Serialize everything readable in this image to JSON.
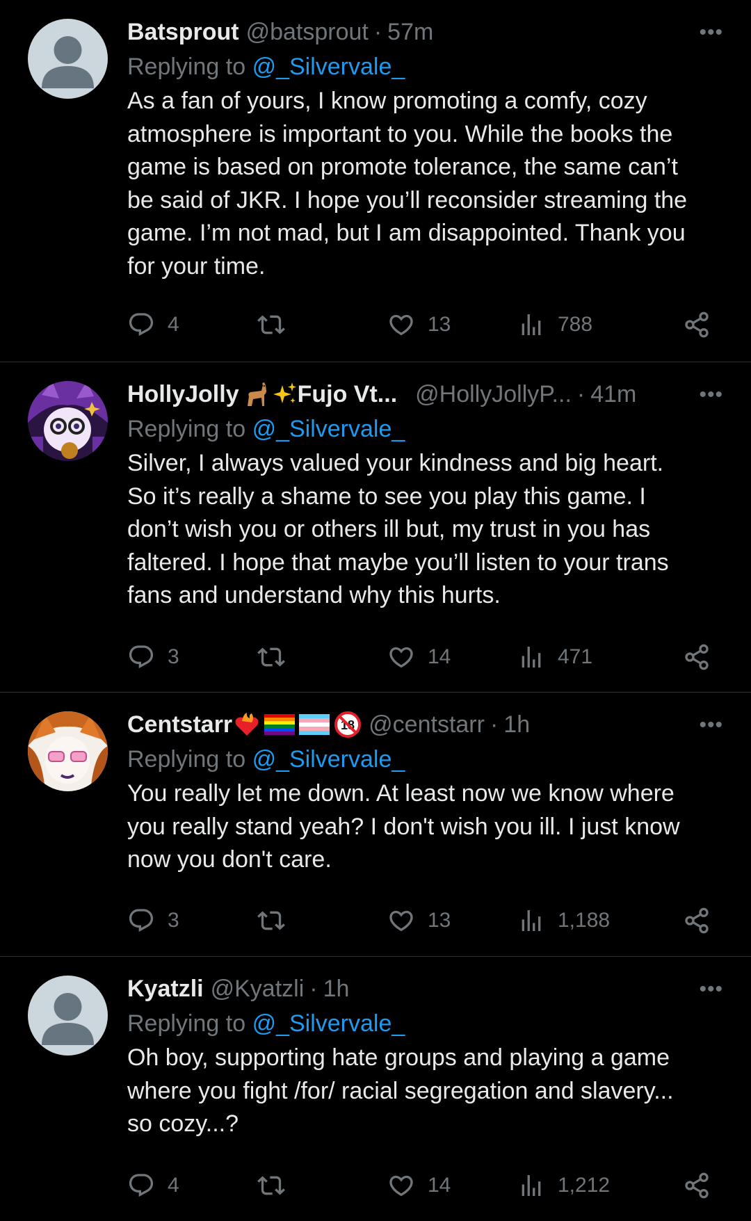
{
  "replying_label": "Replying to",
  "more_label": "•••",
  "tweets": [
    {
      "name": "Batsprout",
      "handle": "@batsprout",
      "time": "57m",
      "mention": "@_Silvervale_",
      "text": "As a fan of yours, I know promoting a comfy, cozy\natmosphere is important to you. While the books the\ngame is based on promote tolerance, the same can’t\nbe said of JKR. I hope you’ll reconsider streaming the\ngame. I’m not mad, but I am disappointed. Thank you\nfor your time.",
      "replies": "4",
      "reposts": "",
      "likes": "13",
      "views": "788"
    },
    {
      "name": "HollyJolly",
      "name_suffix": "Fujo Vt...",
      "handle": "@HollyJollyP...",
      "time": "41m",
      "mention": "@_Silvervale_",
      "text": "Silver, I always valued your kindness and big heart.\nSo it’s really a shame to see you play this game. I\ndon’t wish you or others ill but, my trust in you has\nfaltered. I hope that maybe you’ll listen to your trans\nfans and understand why this hurts.",
      "replies": "3",
      "reposts": "",
      "likes": "14",
      "views": "471"
    },
    {
      "name": "Centstarr",
      "handle": "@centstarr",
      "time": "1h",
      "mention": "@_Silvervale_",
      "text": "You really let me down. At least now we know where\nyou really stand yeah? I don't wish you ill. I just know\nnow you don't care.",
      "replies": "3",
      "reposts": "",
      "likes": "13",
      "views": "1,188"
    },
    {
      "name": "Kyatzli",
      "handle": "@Kyatzli",
      "time": "1h",
      "mention": "@_Silvervale_",
      "text": "Oh boy, supporting hate groups and playing a game\nwhere you fight /for/ racial segregation and slavery...\nso cozy...?",
      "replies": "4",
      "reposts": "",
      "likes": "14",
      "views": "1,212"
    }
  ],
  "icons": {
    "reply": "reply-icon",
    "repost": "repost-icon",
    "like": "like-icon",
    "views": "views-icon",
    "share": "share-icon",
    "more": "more-icon"
  },
  "colors": {
    "background": "#000000",
    "text": "#e7e9ea",
    "muted": "#71767b",
    "link": "#1d9bf0",
    "divider": "#2f3336"
  }
}
